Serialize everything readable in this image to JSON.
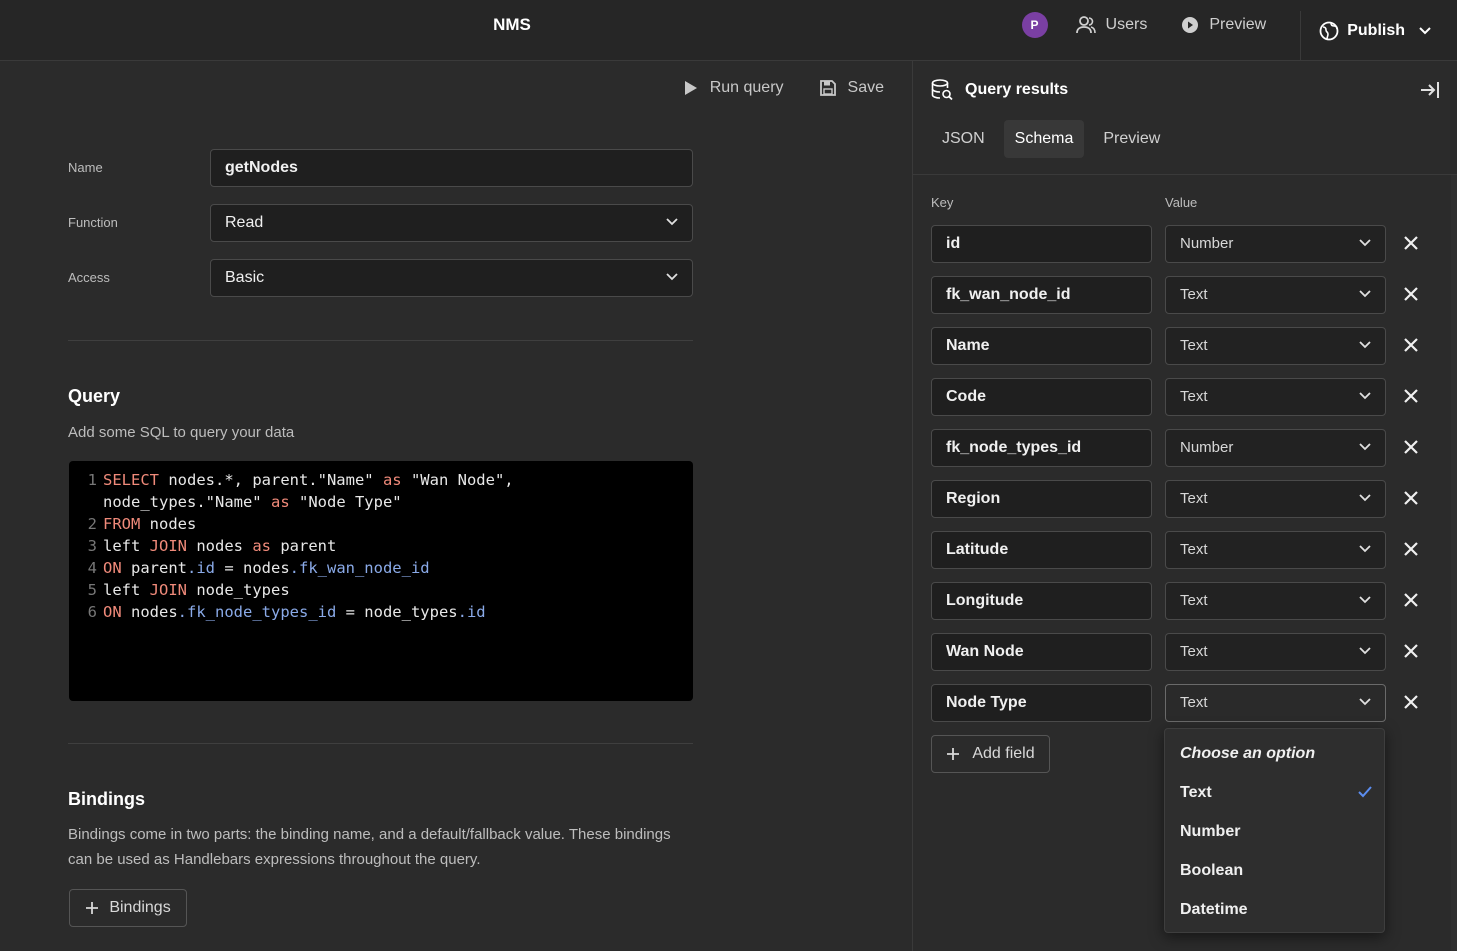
{
  "header": {
    "app_title": "NMS",
    "avatar_initial": "P",
    "users_label": "Users",
    "preview_label": "Preview",
    "publish_label": "Publish"
  },
  "toolbar": {
    "run_query_label": "Run query",
    "save_label": "Save"
  },
  "form": {
    "name_label": "Name",
    "name_value": "getNodes",
    "function_label": "Function",
    "function_value": "Read",
    "access_label": "Access",
    "access_value": "Basic"
  },
  "query_section": {
    "title": "Query",
    "description": "Add some SQL to query your data"
  },
  "bindings_section": {
    "title": "Bindings",
    "description": "Bindings come in two parts: the binding name, and a default/fallback value. These bindings can be used as Handlebars expressions throughout the query.",
    "button_label": "Bindings"
  },
  "results_panel": {
    "title": "Query results",
    "tabs": [
      "JSON",
      "Schema",
      "Preview"
    ],
    "active_tab": "Schema",
    "key_header": "Key",
    "value_header": "Value",
    "add_field_label": "Add field",
    "fields": [
      {
        "key": "id",
        "type": "Number"
      },
      {
        "key": "fk_wan_node_id",
        "type": "Text"
      },
      {
        "key": "Name",
        "type": "Text"
      },
      {
        "key": "Code",
        "type": "Text"
      },
      {
        "key": "fk_node_types_id",
        "type": "Number"
      },
      {
        "key": "Region",
        "type": "Text"
      },
      {
        "key": "Latitude",
        "type": "Text"
      },
      {
        "key": "Longitude",
        "type": "Text"
      },
      {
        "key": "Wan Node",
        "type": "Text"
      },
      {
        "key": "Node Type",
        "type": "Text"
      }
    ]
  },
  "type_dropdown": {
    "placeholder": "Choose an option",
    "options": [
      "Text",
      "Number",
      "Boolean",
      "Datetime"
    ],
    "selected": "Text"
  },
  "colors": {
    "background": "#2b2b2b",
    "topbar": "#262626",
    "avatar": "#7a3fa3",
    "sql_keyword": "#f08a7a",
    "sql_property": "#8aaae8",
    "check": "#5b8def"
  }
}
